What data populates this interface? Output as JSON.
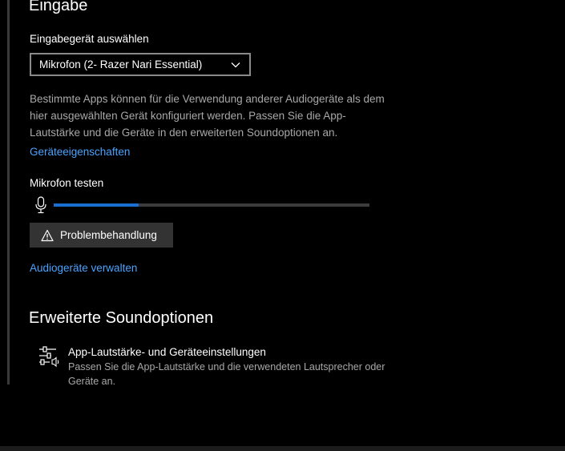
{
  "input_section": {
    "heading": "Eingabe",
    "device_select_label": "Eingabegerät auswählen",
    "device_selected": "Mikrofon (2- Razer Nari Essential)",
    "description": "Bestimmte Apps können für die Verwendung anderer Audiogeräte als dem hier ausgewählten Gerät konfiguriert werden. Passen Sie die App-Lautstärke und die Geräte in den erweiterten Soundoptionen an.",
    "device_properties_link": "Geräteeigenschaften",
    "test_label": "Mikrofon testen",
    "mic_level": 0.27,
    "troubleshoot_label": "Problembehandlung",
    "manage_devices_link": "Audiogeräte verwalten"
  },
  "advanced_section": {
    "heading": "Erweiterte Soundoptionen",
    "app_volume_title": "App-Lautstärke- und Geräteeinstellungen",
    "app_volume_desc": "Passen Sie die App-Lautstärke und die verwendeten Lautsprecher oder Geräte an."
  },
  "icons": {
    "mic": "microphone-icon",
    "warning": "warning-icon",
    "chevron": "chevron-down-icon",
    "mixer": "mixer-icon"
  },
  "colors": {
    "background": "#000000",
    "accent": "#1a6fd0",
    "link": "#4aa3ff",
    "secondary_text": "#a8a8a8",
    "button_bg": "#333333"
  }
}
